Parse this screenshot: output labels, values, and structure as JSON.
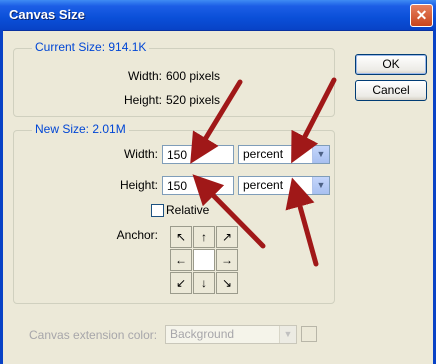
{
  "window": {
    "title": "Canvas Size",
    "close_glyph": "✕"
  },
  "buttons": {
    "ok": "OK",
    "cancel": "Cancel"
  },
  "current_size": {
    "label": "Current Size: 914.1K",
    "width_label": "Width:",
    "width_value": "600 pixels",
    "height_label": "Height:",
    "height_value": "520 pixels"
  },
  "new_size": {
    "label": "New Size: 2.01M",
    "width_label": "Width:",
    "width_value": "150",
    "width_unit": "percent",
    "height_label": "Height:",
    "height_value": "150",
    "height_unit": "percent",
    "relative_label": "Relative",
    "anchor_label": "Anchor:",
    "anchor_glyphs": [
      "↖",
      "↑",
      "↗",
      "←",
      "",
      "→",
      "↙",
      "↓",
      "↘"
    ]
  },
  "extension": {
    "label": "Canvas extension color:",
    "value": "Background"
  },
  "colors": {
    "annotation_arrow": "#a01818",
    "title_bar": "#0a4fd8",
    "group_label": "#0046d5"
  }
}
